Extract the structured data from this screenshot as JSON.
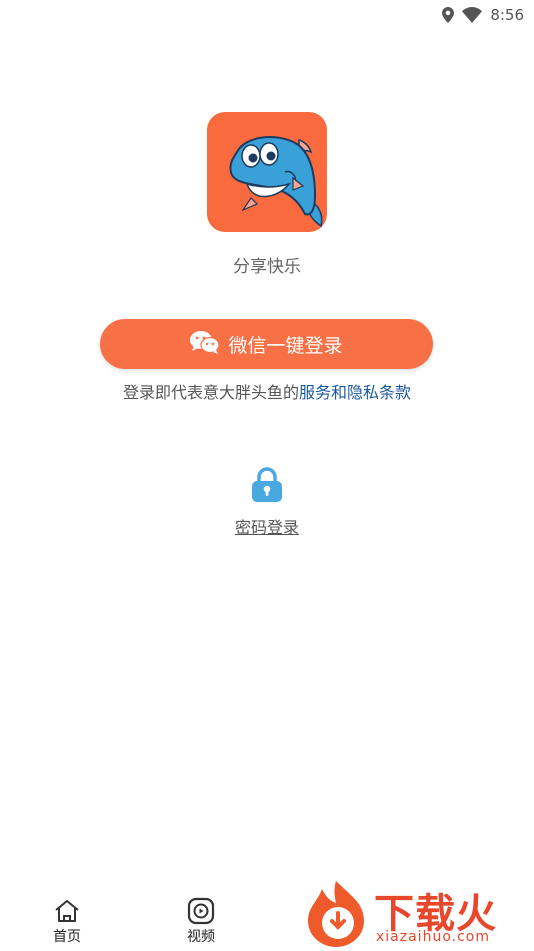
{
  "status_bar": {
    "time": "8:56"
  },
  "app": {
    "slogan": "分享快乐",
    "brand_color": "#f96a3e"
  },
  "login": {
    "wechat_button": "微信一键登录",
    "terms_prefix": "登录即代表意大胖头鱼的",
    "terms_link": "服务和隐私条款",
    "password_login": "密码登录"
  },
  "tabbar": {
    "items": [
      {
        "label": "首页",
        "icon": "home-icon"
      },
      {
        "label": "视频",
        "icon": "video-icon"
      }
    ]
  },
  "watermark": {
    "title": "下载火",
    "url": "xiazaihuo.com"
  }
}
